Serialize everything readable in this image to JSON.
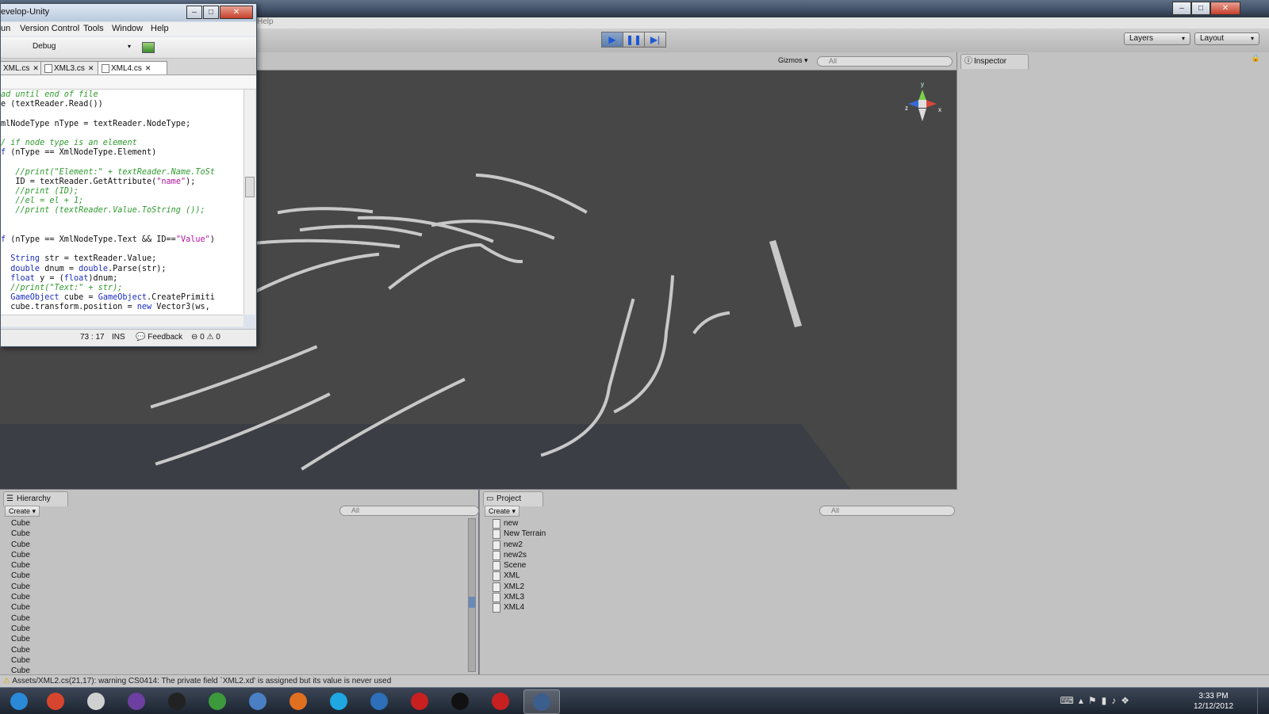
{
  "unity": {
    "toolbar": {
      "layers_label": "Layers",
      "layout_label": "Layout"
    },
    "menubar": {
      "partial_help": "Help"
    },
    "scene": {
      "gizmos_label": "Gizmos",
      "search_placeholder": "All"
    },
    "inspector": {
      "tab_label": "Inspector"
    },
    "hierarchy": {
      "tab_label": "Hierarchy",
      "create_label": "Create",
      "search_placeholder": "All",
      "items": [
        "Cube",
        "Cube",
        "Cube",
        "Cube",
        "Cube",
        "Cube",
        "Cube",
        "Cube",
        "Cube",
        "Cube",
        "Cube",
        "Cube",
        "Cube",
        "Cube",
        "Cube"
      ]
    },
    "project": {
      "tab_label": "Project",
      "create_label": "Create",
      "search_placeholder": "All",
      "items": [
        {
          "label": "new",
          "icon": "script-icon"
        },
        {
          "label": "New Terrain",
          "icon": "terrain-icon"
        },
        {
          "label": "new2",
          "icon": "script-icon"
        },
        {
          "label": "new2s",
          "icon": "script-icon"
        },
        {
          "label": "Scene",
          "icon": "unity-scene-icon"
        },
        {
          "label": "XML",
          "icon": "script-icon"
        },
        {
          "label": "XML2",
          "icon": "script-icon"
        },
        {
          "label": "XML3",
          "icon": "script-icon"
        },
        {
          "label": "XML4",
          "icon": "script-icon"
        }
      ]
    },
    "status": "Assets/XML2.cs(21,17): warning CS0414: The private field `XML2.xd' is assigned but its value is never used"
  },
  "monodevelop": {
    "title": "evelop-Unity",
    "menu": [
      "un",
      "Version Control",
      "Tools",
      "Window",
      "Help"
    ],
    "config": "Debug",
    "tabs": [
      "XML.cs",
      "XML3.cs",
      "XML4.cs"
    ],
    "code": [
      [
        {
          "t": "ad until end of file",
          "c": "comment"
        }
      ],
      [
        {
          "t": "e (textReader.Read())",
          "c": ""
        }
      ],
      [
        {
          "t": "",
          "c": ""
        }
      ],
      [
        {
          "t": "mlNodeType nType = textReader.NodeType;",
          "c": ""
        }
      ],
      [
        {
          "t": "",
          "c": ""
        }
      ],
      [
        {
          "t": "/ if node type is an element",
          "c": "comment"
        }
      ],
      [
        {
          "t": "f",
          "c": "kw"
        },
        {
          "t": " (nType == XmlNodeType.Element)",
          "c": ""
        }
      ],
      [
        {
          "t": "",
          "c": ""
        }
      ],
      [
        {
          "t": "   //print(\"Element:\" + textReader.Name.ToSt",
          "c": "comment"
        }
      ],
      [
        {
          "t": "   ID = textReader.GetAttribute(",
          "c": ""
        },
        {
          "t": "\"name\"",
          "c": "str"
        },
        {
          "t": ");",
          "c": ""
        }
      ],
      [
        {
          "t": "   //print (ID);",
          "c": "comment"
        }
      ],
      [
        {
          "t": "   //el = el + 1;",
          "c": "comment"
        }
      ],
      [
        {
          "t": "   //print (textReader.Value.ToString ());",
          "c": "comment"
        }
      ],
      [
        {
          "t": "",
          "c": ""
        }
      ],
      [
        {
          "t": "",
          "c": ""
        }
      ],
      [
        {
          "t": "f",
          "c": "kw"
        },
        {
          "t": " (nType == XmlNodeType.Text && ID==",
          "c": ""
        },
        {
          "t": "\"Value\"",
          "c": "str"
        },
        {
          "t": ")",
          "c": ""
        }
      ],
      [
        {
          "t": "",
          "c": ""
        }
      ],
      [
        {
          "t": "  String",
          "c": "kw"
        },
        {
          "t": " str = textReader.Value;",
          "c": ""
        }
      ],
      [
        {
          "t": "  double",
          "c": "kw"
        },
        {
          "t": " dnum = ",
          "c": ""
        },
        {
          "t": "double",
          "c": "kw"
        },
        {
          "t": ".Parse(str);",
          "c": ""
        }
      ],
      [
        {
          "t": "  float",
          "c": "kw"
        },
        {
          "t": " y = (",
          "c": ""
        },
        {
          "t": "float",
          "c": "kw"
        },
        {
          "t": ")dnum;",
          "c": ""
        }
      ],
      [
        {
          "t": "  //print(\"Text:\" + str);",
          "c": "comment"
        }
      ],
      [
        {
          "t": "  GameObject",
          "c": "kw"
        },
        {
          "t": " cube = ",
          "c": ""
        },
        {
          "t": "GameObject",
          "c": "kw"
        },
        {
          "t": ".CreatePrimiti",
          "c": ""
        }
      ],
      [
        {
          "t": "  cube.transform.position = ",
          "c": ""
        },
        {
          "t": "new",
          "c": "kw"
        },
        {
          "t": " Vector3(ws,",
          "c": ""
        }
      ]
    ],
    "status": {
      "position": "73 : 17",
      "mode": "INS",
      "feedback": "Feedback",
      "errors": "0",
      "warnings": "0"
    }
  },
  "taskbar": {
    "apps": [
      "windows-start-icon",
      "chrome-icon",
      "unity-icon",
      "eclipse-icon",
      "p-app-icon",
      "evernote-icon",
      "python-icon",
      "firefox-icon",
      "skype-icon",
      "tool-icon",
      "c-app-icon",
      "cmd-icon",
      "s-app-icon",
      "monodevelop-icon"
    ],
    "time": "3:33 PM",
    "date": "12/12/2012"
  }
}
